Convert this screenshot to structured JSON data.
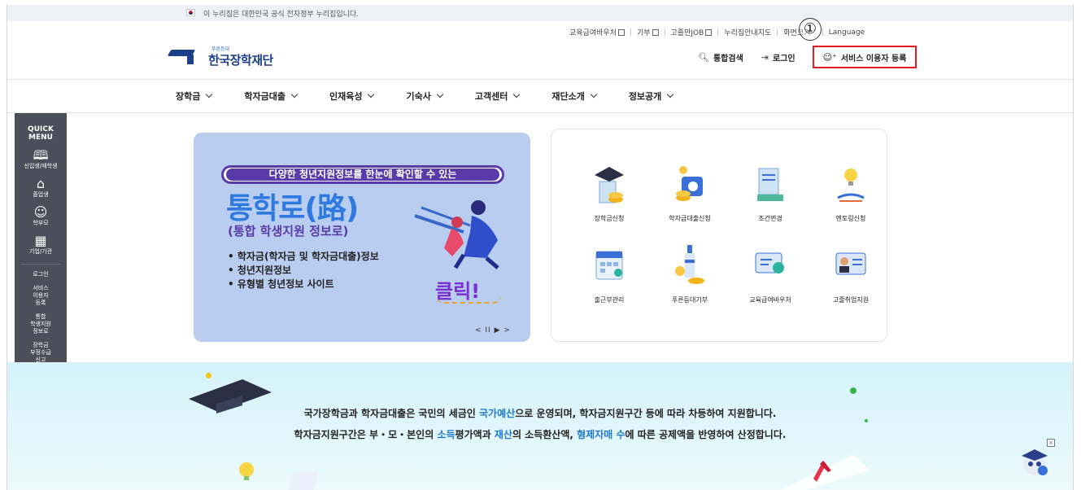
{
  "gov_notice": "이 누리집은 대한민국 공식 전자정부 누리집입니다.",
  "util_links": [
    {
      "label": "교육급여바우처",
      "external": true
    },
    {
      "label": "기부",
      "external": true
    },
    {
      "label": "고졸만JOB",
      "external": true
    },
    {
      "label": "누리집안내지도",
      "external": false
    },
    {
      "label": "화면크기",
      "dropdown": true
    },
    {
      "label": "Language",
      "external": false
    }
  ],
  "annotation_marker": "①",
  "logo": {
    "tagline": "푸른등대",
    "name": "한국장학재단",
    "color": "#1c3f8a"
  },
  "header_actions": {
    "search": "통합검색",
    "login": "로그인",
    "register": "서비스 이용자 등록",
    "register_border_color": "#e31b23"
  },
  "nav": [
    "장학금",
    "학자금대출",
    "인재육성",
    "기숙사",
    "고객센터",
    "재단소개",
    "정보공개"
  ],
  "quick_menu": {
    "title": "QUICK\nMENU",
    "icon_items": [
      {
        "icon": "book-icon",
        "label": "신입생/재학생"
      },
      {
        "icon": "graduation-cap-icon",
        "label": "졸업생"
      },
      {
        "icon": "parents-icon",
        "label": "학부모"
      },
      {
        "icon": "building-icon",
        "label": "기업/기관"
      }
    ],
    "text_items": [
      "로그인",
      "서비스\n이용자\n등록",
      "통합\n학생지원\n정보로",
      "장학금\n부정수급\n신고"
    ]
  },
  "banner": {
    "pill_text": "다양한 청년지원정보를 한눈에 확인할 수 있는",
    "headline": "통학로(路)",
    "subtitle": "(통합 학생지원 정보로)",
    "bullets": [
      "• 학자금(학자금 및 학자금대출)정보",
      "• 청년지원정보",
      "• 유형별 청년정보 사이트"
    ],
    "click_text": "클릭!",
    "controls": "< II ▶ >",
    "background": "#b9cdf1"
  },
  "services": [
    {
      "label": "장학금신청",
      "icon": "scholarship-apply-icon"
    },
    {
      "label": "학자금대출신청",
      "icon": "loan-apply-icon"
    },
    {
      "label": "조건변경",
      "icon": "condition-change-icon"
    },
    {
      "label": "멘토링신청",
      "icon": "mentoring-icon"
    },
    {
      "label": "출근부관리",
      "icon": "attendance-calendar-icon"
    },
    {
      "label": "푸른등대기부",
      "icon": "donation-lighthouse-icon"
    },
    {
      "label": "교육급여바우처",
      "icon": "voucher-icon"
    },
    {
      "label": "고졸취업지원",
      "icon": "employment-support-icon"
    }
  ],
  "notice": {
    "line1": [
      {
        "t": "국가장학금과 학자금대출은 국민의 세금인 "
      },
      {
        "t": "국가예산",
        "hl": true
      },
      {
        "t": "으로 운영되며, 학자금지원구간 등에 따라 차등하여 지원합니다."
      }
    ],
    "line2": [
      {
        "t": "학자금지원구간은 부・모・본인의 "
      },
      {
        "t": "소득",
        "hl": true
      },
      {
        "t": "평가액과 "
      },
      {
        "t": "재산",
        "hl": true
      },
      {
        "t": "의 소득환산액, "
      },
      {
        "t": "형제자매 수",
        "hl": true
      },
      {
        "t": "에 따른 공제액을 반영하여 산정합니다."
      }
    ],
    "highlight_color": "#1e7ad0"
  },
  "close_label": "×"
}
